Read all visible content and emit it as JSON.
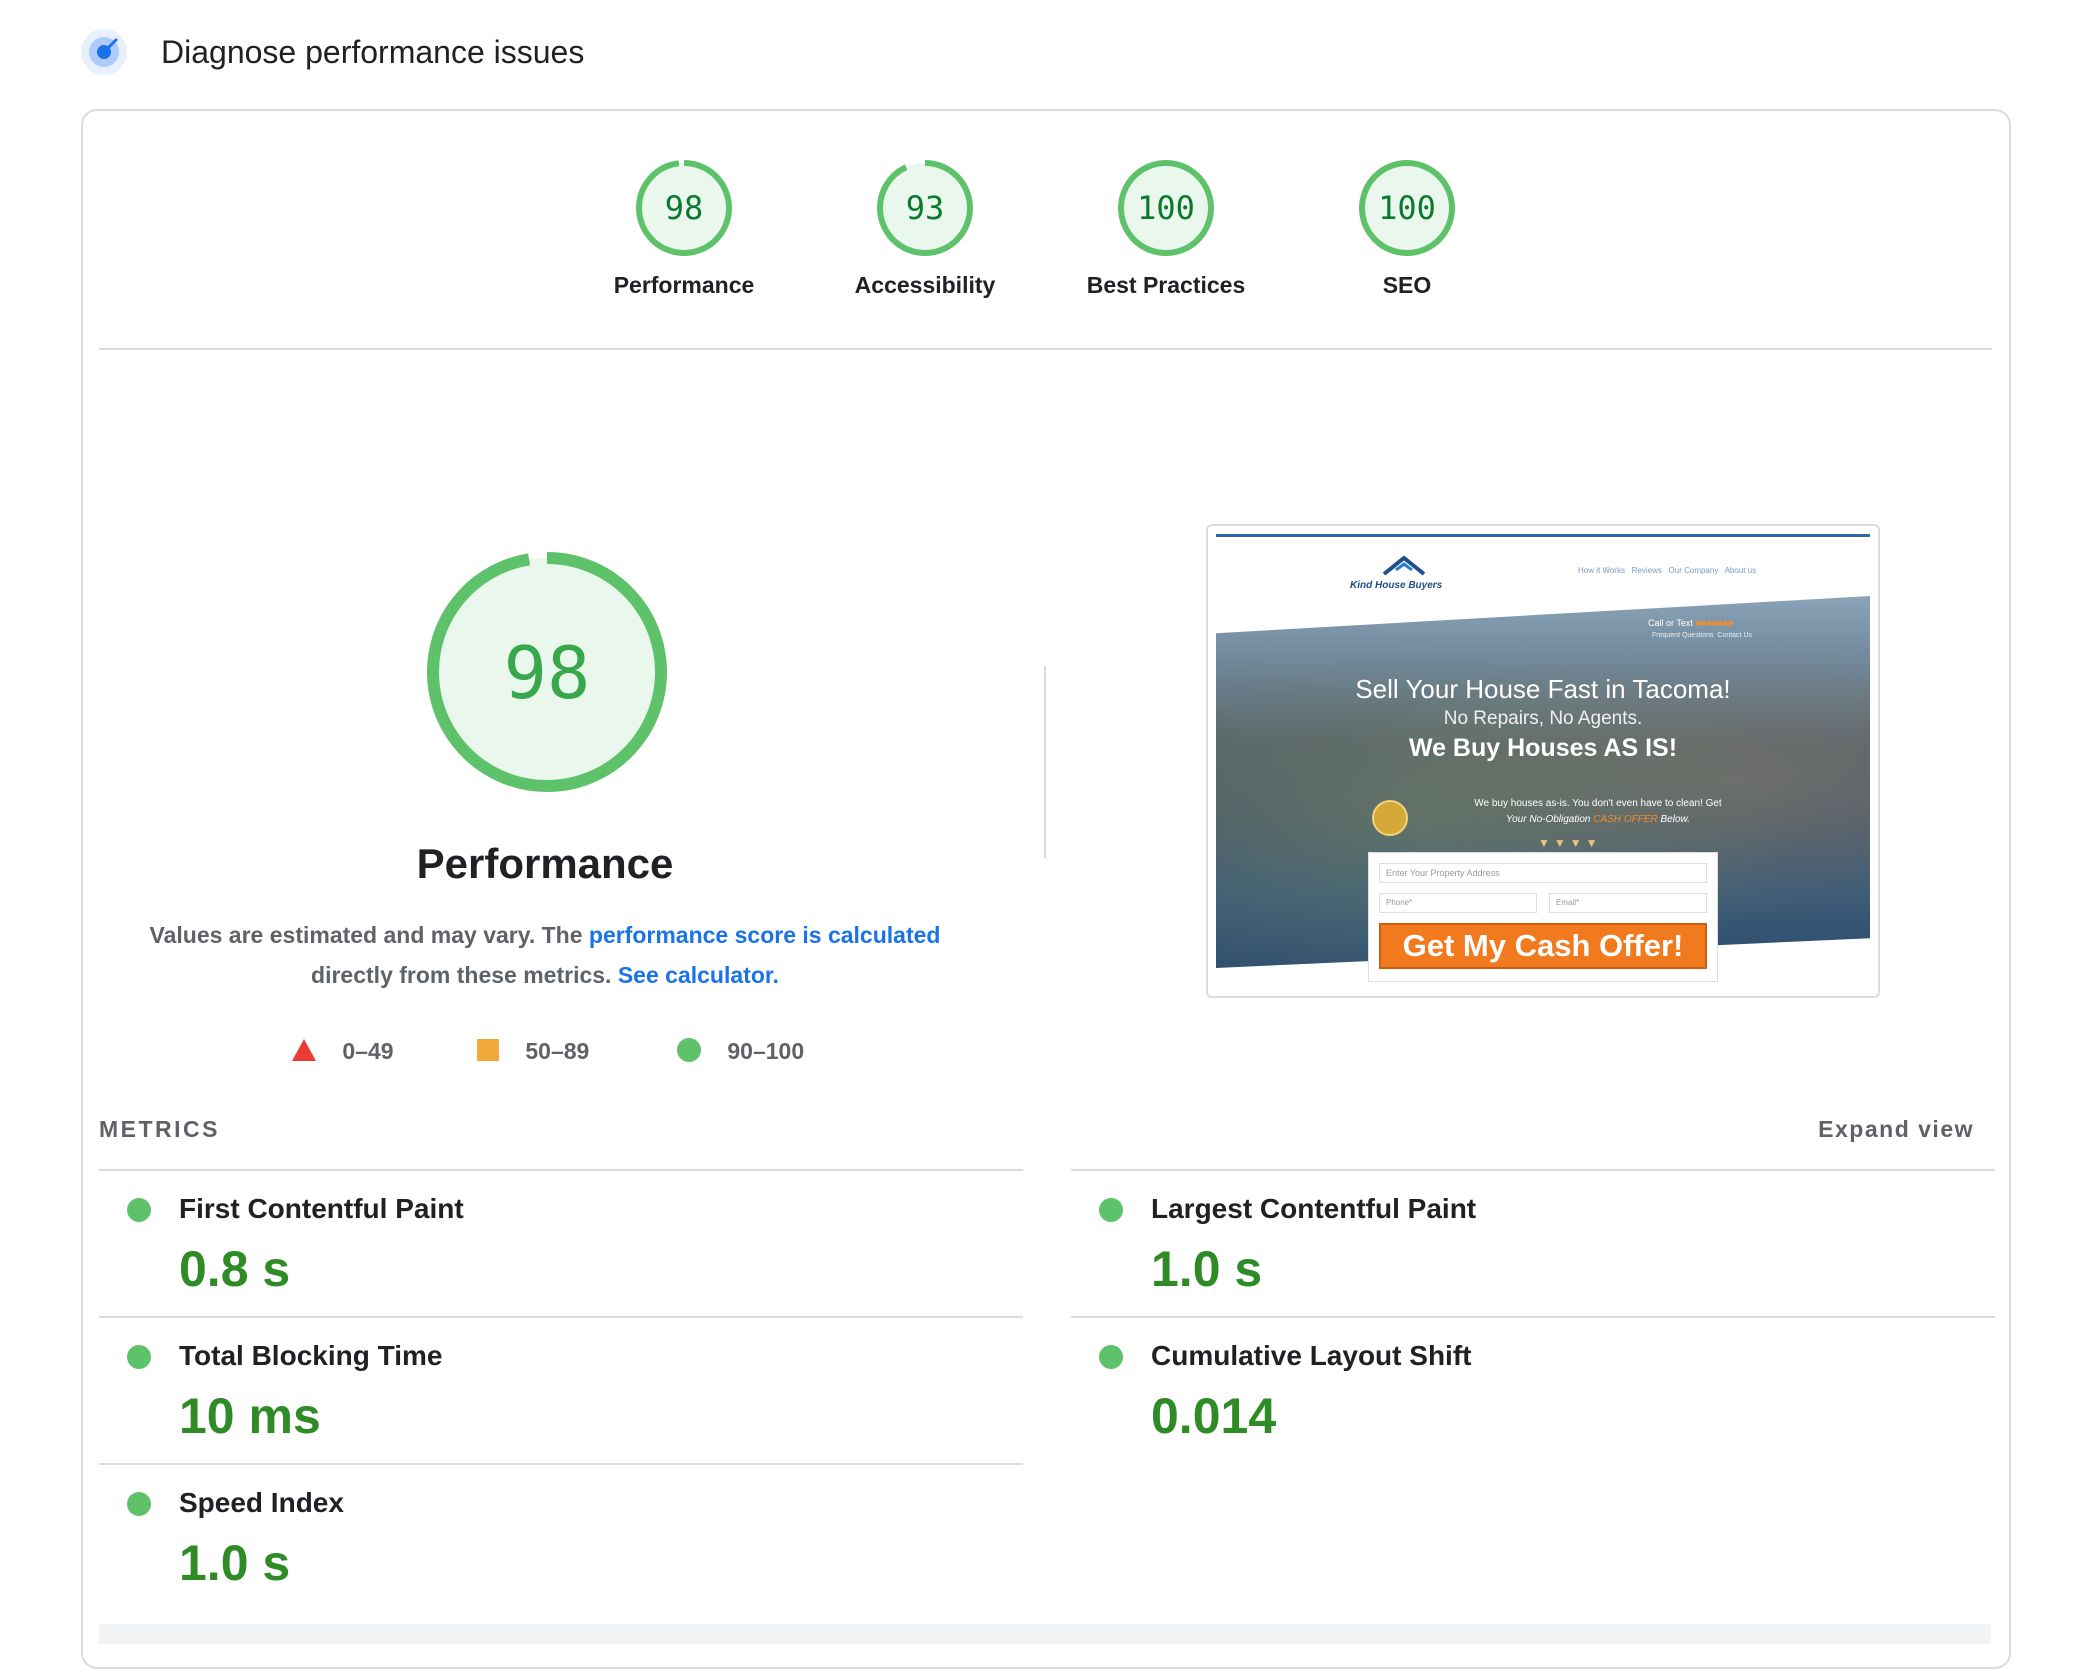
{
  "header": {
    "title": "Diagnose performance issues",
    "icon": "lighthouse-icon"
  },
  "categories": [
    {
      "score": "98",
      "label": "Performance"
    },
    {
      "score": "93",
      "label": "Accessibility"
    },
    {
      "score": "100",
      "label": "Best Practices"
    },
    {
      "score": "100",
      "label": "SEO"
    }
  ],
  "performance": {
    "score": "98",
    "title": "Performance",
    "desc_prefix": "Values are estimated and may vary. The ",
    "desc_link1": "performance score is calculated",
    "desc_middle": "directly from these metrics. ",
    "desc_link2": "See calculator",
    "desc_suffix": "."
  },
  "legend": {
    "fail": "0–49",
    "average": "50–89",
    "pass": "90–100"
  },
  "thumbnail": {
    "brand": "Kind House Buyers",
    "nav": [
      "How it Works",
      "Reviews",
      "Our Company",
      "About us"
    ],
    "call_text": "Call or Text",
    "nav2": [
      "Frequent Questions",
      "Contact Us"
    ],
    "headline1": "Sell Your House Fast in Tacoma!",
    "headline2": "No Repairs, No Agents.",
    "headline3": "We Buy Houses AS IS!",
    "body1": "We buy houses as-is. You don't even have to clean! Get",
    "body2a": "Your No-Obligation ",
    "body2b": "CASH OFFER",
    "body2c": " Below.",
    "address_placeholder": "Enter Your Property Address",
    "phone_placeholder": "Phone*",
    "email_placeholder": "Email*",
    "cta": "Get My Cash Offer!"
  },
  "metrics": {
    "heading": "METRICS",
    "expand": "Expand view",
    "items": [
      {
        "title": "First Contentful Paint",
        "value": "0.8 s"
      },
      {
        "title": "Largest Contentful Paint",
        "value": "1.0 s"
      },
      {
        "title": "Total Blocking Time",
        "value": "10 ms"
      },
      {
        "title": "Cumulative Layout Shift",
        "value": "0.014"
      },
      {
        "title": "Speed Index",
        "value": "1.0 s"
      }
    ]
  },
  "colors": {
    "pass": "#0cce6b",
    "pass_text": "#0c7a2e",
    "average": "#ffa400",
    "fail": "#ff4e42",
    "link": "#1a73e8"
  }
}
